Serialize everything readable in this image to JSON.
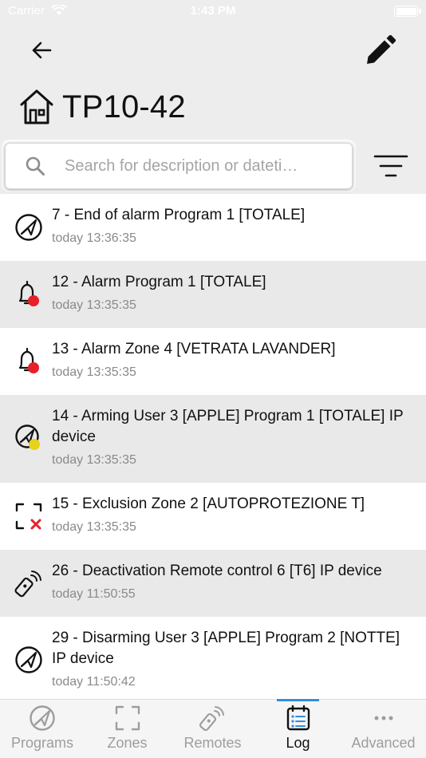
{
  "status_bar": {
    "carrier": "Carrier",
    "time": "1:43 PM"
  },
  "header": {
    "back_icon": "arrow-left-icon",
    "edit_icon": "pencil-icon",
    "home_icon": "house-icon",
    "title": "TP10-42"
  },
  "search": {
    "placeholder": "Search for description or dateti…",
    "value": ""
  },
  "filter_icon": "filter-lines-icon",
  "log_entries": [
    {
      "title": "7 - End of alarm Program 1 [TOTALE]",
      "time": "today 13:36:35",
      "icon": "end-alarm-icon"
    },
    {
      "title": "12 - Alarm Program 1 [TOTALE]",
      "time": "today 13:35:35",
      "icon": "bell-alarm-icon"
    },
    {
      "title": "13 - Alarm Zone 4 [VETRATA LAVANDER]",
      "time": "today 13:35:35",
      "icon": "bell-alarm-icon"
    },
    {
      "title": "14 - Arming User 3 [APPLE] Program 1 [TOTALE] IP device",
      "time": "today 13:35:35",
      "icon": "arming-icon"
    },
    {
      "title": "15 - Exclusion Zone 2 [AUTOPROTEZIONE T]",
      "time": "today 13:35:35",
      "icon": "zone-exclusion-icon"
    },
    {
      "title": "26 - Deactivation Remote control 6 [T6] IP device",
      "time": "today 11:50:55",
      "icon": "remote-control-icon"
    },
    {
      "title": "29 - Disarming User 3 [APPLE] Program 2 [NOTTE] IP device",
      "time": "today 11:50:42",
      "icon": "disarming-icon"
    }
  ],
  "tabs": [
    {
      "label": "Programs",
      "icon": "programs-icon",
      "active": false
    },
    {
      "label": "Zones",
      "icon": "zones-icon",
      "active": false
    },
    {
      "label": "Remotes",
      "icon": "remotes-icon",
      "active": false
    },
    {
      "label": "Log",
      "icon": "log-icon",
      "active": true
    },
    {
      "label": "Advanced",
      "icon": "more-dots-icon",
      "active": false
    }
  ],
  "colors": {
    "background": "#ededed",
    "alarm_red": "#e8202a",
    "arming_yellow": "#e8d21a",
    "active_tab_indicator": "#2f8ee0",
    "inactive_tab": "#9d9d9d"
  }
}
